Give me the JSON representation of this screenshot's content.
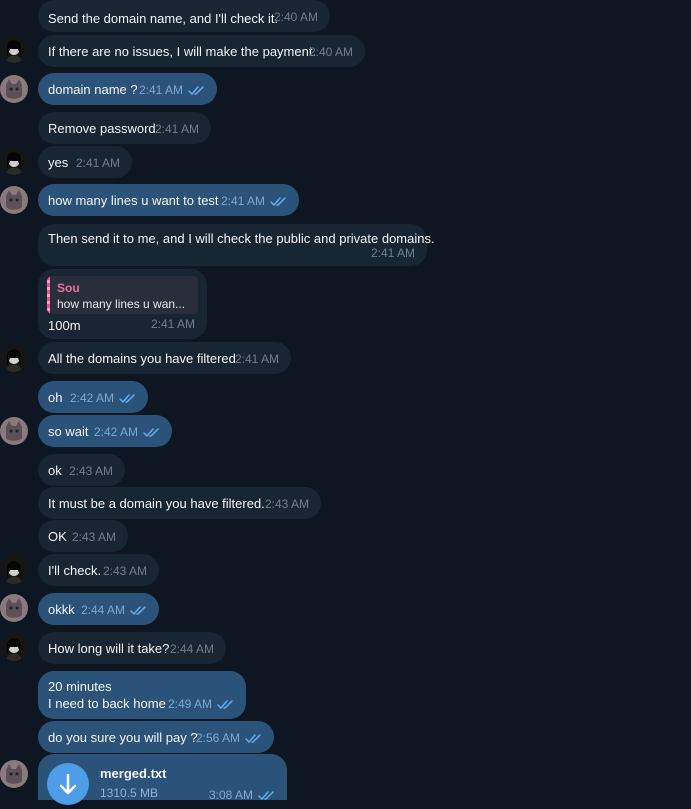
{
  "messages": [
    {
      "text": "Send the domain name, and I'll check it.",
      "time": "2:40 AM"
    },
    {
      "text": "If there are no issues, I will make the payment.",
      "time": "2:40 AM"
    },
    {
      "text": "domain name ?",
      "time": "2:41 AM"
    },
    {
      "text": "Remove password",
      "time": "2:41 AM"
    },
    {
      "text": "yes",
      "time": "2:41 AM"
    },
    {
      "text": "how many lines u want to test",
      "time": "2:41 AM"
    },
    {
      "text": "Then send it to me, and I will check the public and private domains.",
      "time": "2:41 AM"
    },
    {
      "text": "100m",
      "time": "2:41 AM",
      "reply_name": "Sou",
      "reply_text": "how many lines u wan..."
    },
    {
      "text": "All the domains you have filtered",
      "time": "2:41 AM"
    },
    {
      "text": "oh",
      "time": "2:42 AM"
    },
    {
      "text": "so wait",
      "time": "2:42 AM"
    },
    {
      "text": "ok",
      "time": "2:43 AM"
    },
    {
      "text": "It must be a domain you have filtered.",
      "time": "2:43 AM"
    },
    {
      "text": "OK",
      "time": "2:43 AM"
    },
    {
      "text": "I'll check.",
      "time": "2:43 AM"
    },
    {
      "text": "okkk",
      "time": "2:44 AM"
    },
    {
      "text": "How long will it take?",
      "time": "2:44 AM"
    },
    {
      "text": "20 minutes\nI need to back home",
      "time": "2:49 AM"
    },
    {
      "text": "do you sure you will pay ?",
      "time": "2:56 AM"
    }
  ],
  "file": {
    "name": "merged.txt",
    "size": "1310.5 MB",
    "time": "3:08 AM"
  },
  "colors": {
    "background": "#0e1621",
    "incoming": "#182533",
    "outgoing": "#2b5278",
    "accent": "#4f9de8"
  }
}
